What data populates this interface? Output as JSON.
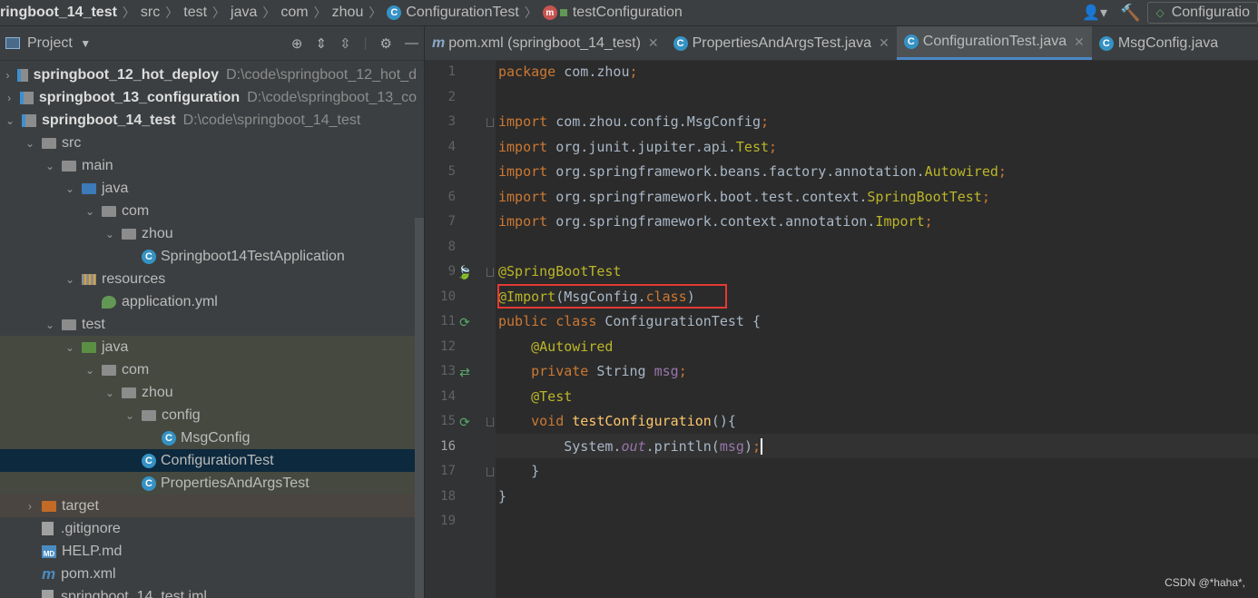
{
  "breadcrumb": {
    "items": [
      "ringboot_14_test",
      "src",
      "test",
      "java",
      "com",
      "zhou",
      "ConfigurationTest",
      "testConfiguration"
    ],
    "run_config": "Configuratio"
  },
  "project_panel": {
    "title": "Project",
    "tree": [
      {
        "label": "springboot_12_hot_deploy",
        "path": "D:\\code\\springboot_12_hot_d",
        "depth": 0,
        "kind": "module",
        "arrow": "›",
        "bold": true
      },
      {
        "label": "springboot_13_configuration",
        "path": "D:\\code\\springboot_13_co",
        "depth": 0,
        "kind": "module",
        "arrow": "›",
        "bold": true
      },
      {
        "label": "springboot_14_test",
        "path": "D:\\code\\springboot_14_test",
        "depth": 0,
        "kind": "module",
        "arrow": "⌄",
        "bold": true
      },
      {
        "label": "src",
        "depth": 1,
        "kind": "folder",
        "arrow": "⌄"
      },
      {
        "label": "main",
        "depth": 2,
        "kind": "folder",
        "arrow": "⌄"
      },
      {
        "label": "java",
        "depth": 3,
        "kind": "folder-blue",
        "arrow": "⌄"
      },
      {
        "label": "com",
        "depth": 4,
        "kind": "package",
        "arrow": "⌄"
      },
      {
        "label": "zhou",
        "depth": 5,
        "kind": "package",
        "arrow": "⌄"
      },
      {
        "label": "Springboot14TestApplication",
        "depth": 6,
        "kind": "class"
      },
      {
        "label": "resources",
        "depth": 3,
        "kind": "resources",
        "arrow": "⌄"
      },
      {
        "label": "application.yml",
        "depth": 4,
        "kind": "yml"
      },
      {
        "label": "test",
        "depth": 2,
        "kind": "folder",
        "arrow": "⌄"
      },
      {
        "label": "java",
        "depth": 3,
        "kind": "folder-green",
        "arrow": "⌄"
      },
      {
        "label": "com",
        "depth": 4,
        "kind": "package",
        "arrow": "⌄"
      },
      {
        "label": "zhou",
        "depth": 5,
        "kind": "package",
        "arrow": "⌄"
      },
      {
        "label": "config",
        "depth": 6,
        "kind": "package",
        "arrow": "⌄"
      },
      {
        "label": "MsgConfig",
        "depth": 7,
        "kind": "class"
      },
      {
        "label": "ConfigurationTest",
        "depth": 6,
        "kind": "class",
        "selected": true
      },
      {
        "label": "PropertiesAndArgsTest",
        "depth": 6,
        "kind": "class"
      },
      {
        "label": "target",
        "depth": 1,
        "kind": "folder-orange",
        "arrow": "›"
      },
      {
        "label": ".gitignore",
        "depth": 1,
        "kind": "file"
      },
      {
        "label": "HELP.md",
        "depth": 1,
        "kind": "md"
      },
      {
        "label": "pom.xml",
        "depth": 1,
        "kind": "maven"
      },
      {
        "label": "springboot_14_test.iml",
        "depth": 1,
        "kind": "file"
      }
    ]
  },
  "tabs": [
    {
      "label": "pom.xml (springboot_14_test)",
      "icon": "maven",
      "active": false
    },
    {
      "label": "PropertiesAndArgsTest.java",
      "icon": "class",
      "active": false
    },
    {
      "label": "ConfigurationTest.java",
      "icon": "class",
      "active": true
    },
    {
      "label": "MsgConfig.java",
      "icon": "class",
      "active": false
    }
  ],
  "editor": {
    "current_line": 16,
    "lines": [
      [
        [
          "kw",
          "package "
        ],
        [
          "t",
          "com.zhou"
        ],
        [
          "kw",
          ";"
        ]
      ],
      [],
      [
        [
          "kw",
          "import "
        ],
        [
          "t",
          "com.zhou.config.MsgConfig"
        ],
        [
          "kw",
          ";"
        ]
      ],
      [
        [
          "kw",
          "import "
        ],
        [
          "t",
          "org.junit.jupiter.api."
        ],
        [
          "ann",
          "Test"
        ],
        [
          "kw",
          ";"
        ]
      ],
      [
        [
          "kw",
          "import "
        ],
        [
          "t",
          "org.springframework.beans.factory.annotation."
        ],
        [
          "ann",
          "Autowired"
        ],
        [
          "kw",
          ";"
        ]
      ],
      [
        [
          "kw",
          "import "
        ],
        [
          "t",
          "org.springframework.boot.test.context."
        ],
        [
          "ann",
          "SpringBootTest"
        ],
        [
          "kw",
          ";"
        ]
      ],
      [
        [
          "kw",
          "import "
        ],
        [
          "t",
          "org.springframework.context.annotation."
        ],
        [
          "ann",
          "Import"
        ],
        [
          "kw",
          ";"
        ]
      ],
      [],
      [
        [
          "ann",
          "@SpringBootTest"
        ]
      ],
      [
        [
          "ann",
          "@Import"
        ],
        [
          "t",
          "(MsgConfig."
        ],
        [
          "kw",
          "class"
        ],
        [
          "t",
          ")"
        ]
      ],
      [
        [
          "kw",
          "public class "
        ],
        [
          "t",
          "ConfigurationTest {"
        ]
      ],
      [
        [
          "t",
          "    "
        ],
        [
          "ann",
          "@Autowired"
        ]
      ],
      [
        [
          "t",
          "    "
        ],
        [
          "kw",
          "private "
        ],
        [
          "t",
          "String "
        ],
        [
          "fld",
          "msg"
        ],
        [
          "kw",
          ";"
        ]
      ],
      [
        [
          "t",
          "    "
        ],
        [
          "ann",
          "@Test"
        ]
      ],
      [
        [
          "t",
          "    "
        ],
        [
          "kw",
          "void "
        ],
        [
          "fn",
          "testConfiguration"
        ],
        [
          "t",
          "(){"
        ]
      ],
      [
        [
          "t",
          "        System."
        ],
        [
          "st",
          "out"
        ],
        [
          "t",
          ".println("
        ],
        [
          "fld",
          "msg"
        ],
        [
          "t",
          ")"
        ],
        [
          "kw",
          ";"
        ]
      ],
      [
        [
          "t",
          "    }"
        ]
      ],
      [
        [
          "t",
          "}"
        ]
      ],
      []
    ]
  },
  "watermark": "CSDN @*haha*,"
}
